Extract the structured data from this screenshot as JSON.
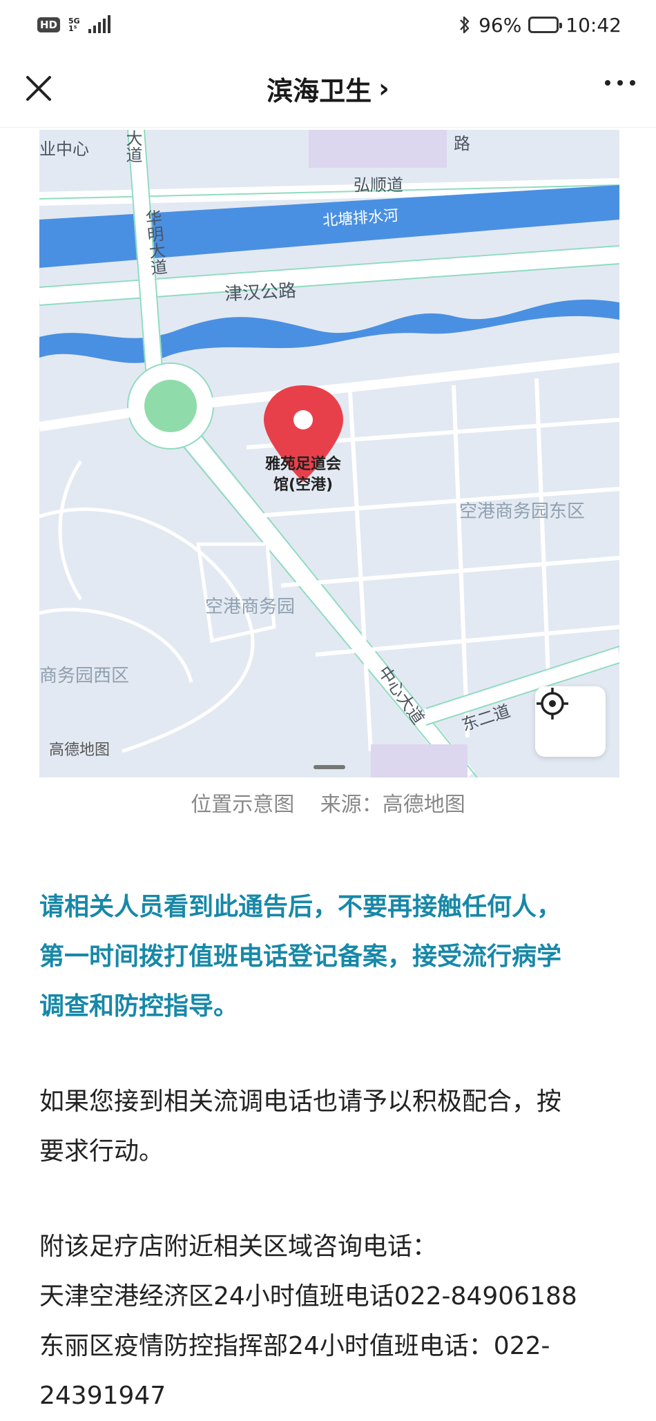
{
  "status_bar": {
    "hd": "HD",
    "network": "5G",
    "network_sub": "1⁵",
    "battery": "96%",
    "time": "10:42"
  },
  "nav": {
    "title": "滨海卫生",
    "title_arrow": "›"
  },
  "map": {
    "labels": {
      "center_top": "业中心",
      "road_da": "大道",
      "road_lu": "路",
      "hongshun": "弘顺道",
      "beitang": "北塘排水河",
      "huaming": "华明大道",
      "jinhan": "津汉公路",
      "poi_line1": "雅苑足道会",
      "poi_line2": "馆(空港)",
      "east_district": "空港商务园东区",
      "business_park": "空港商务园",
      "west_district": "商务园西区",
      "zhongxin": "中心大道",
      "dong_er": "东二道",
      "brand": "高德地图"
    }
  },
  "caption": {
    "left": "位置示意图",
    "right": "来源：高德地图"
  },
  "article": {
    "highlight_lines": [
      "请相关人员看到此通告后，不要再接触任何人，",
      "第一时间拨打值班电话登记备案，接受流行病学",
      "调查和防控指导。"
    ],
    "para2_lines": [
      "如果您接到相关流调电话也请予以积极配合，按",
      "要求行动。"
    ],
    "para3_lines": [
      "附该足疗店附近相关区域咨询电话：",
      "天津空港经济区24小时值班电话022-84906188",
      "东丽区疫情防控指挥部24小时值班电话：022-",
      "24391947"
    ]
  },
  "colors": {
    "highlight": "#1788a8",
    "river": "#4a90e2",
    "road_outline": "#7fd1b1",
    "pin": "#e8404a"
  }
}
